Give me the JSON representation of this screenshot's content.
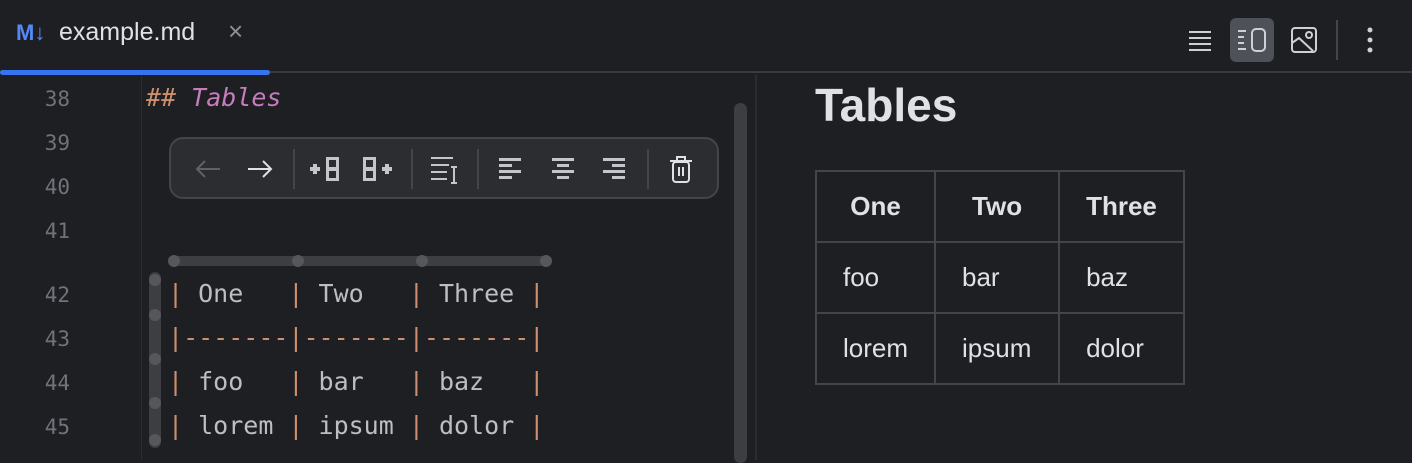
{
  "tab": {
    "icon": "M↓",
    "filename": "example.md",
    "close": "×"
  },
  "toolbar_right": {
    "modes": [
      "editor-only",
      "editor-and-preview",
      "preview-only"
    ],
    "active": "editor-and-preview"
  },
  "editor": {
    "lines": [
      {
        "n": "38"
      },
      {
        "n": "39"
      },
      {
        "n": "40"
      },
      {
        "n": "41"
      },
      {
        "n": "42"
      },
      {
        "n": "43"
      },
      {
        "n": "44"
      },
      {
        "n": "45"
      }
    ],
    "heading_marker": "##",
    "heading_text": "Tables",
    "table_lines": [
      [
        "| ",
        "One   ",
        "| ",
        "Two   ",
        "| ",
        "Three ",
        "|"
      ],
      [
        "|",
        "-------",
        "|",
        "-------",
        "|",
        "-------",
        "|"
      ],
      [
        "| ",
        "foo   ",
        "| ",
        "bar   ",
        "| ",
        "baz   ",
        "|"
      ],
      [
        "| ",
        "lorem ",
        "| ",
        "ipsum ",
        "| ",
        "dolor ",
        "|"
      ]
    ],
    "table_toolbar": [
      "arrow-left",
      "arrow-right",
      "insert-column-before",
      "insert-column-after",
      "format-table",
      "align-left",
      "align-center",
      "align-right",
      "delete"
    ]
  },
  "preview": {
    "title": "Tables",
    "headers": [
      "One",
      "Two",
      "Three"
    ],
    "rows": [
      [
        "foo",
        "bar",
        "baz"
      ],
      [
        "lorem",
        "ipsum",
        "dolor"
      ]
    ]
  }
}
